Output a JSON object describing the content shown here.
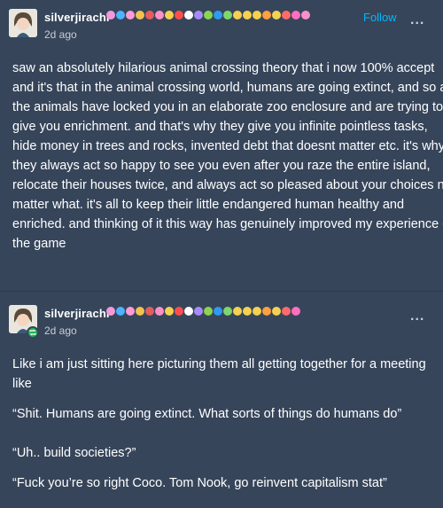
{
  "post1": {
    "username": "silverjirachi",
    "follow_label": "Follow",
    "timestamp": "2d ago",
    "more_label": "...",
    "badges": [
      "#f29ad8",
      "#4cb3ff",
      "#ff9ad5",
      "#f2c14e",
      "#e65c5c",
      "#ff8fc7",
      "#f5d14f",
      "#ff4d4d",
      "#ffffff",
      "#a78bfa",
      "#8bd450",
      "#2e9bf0",
      "#7fd66b",
      "#f5d14f",
      "#f5d14f",
      "#f5d14f",
      "#ff9f40",
      "#f5d14f",
      "#ff6b6b",
      "#ff6fbf",
      "#ff8fc7"
    ],
    "text": "saw an absolutely hilarious animal crossing theory that i now 100% accept and it's that in the animal crossing world, humans are going extinct, and so all the animals have locked you in an elaborate zoo enclosure and are trying to give you enrichment. and that's why they give you infinite pointless tasks, hide money in trees and rocks, invented debt that doesnt matter etc. it's why they always act so happy to see you even after you raze the entire island, relocate their houses twice, and always act so pleased about your choices no matter what.  it's all to keep their little endangered human healthy and enriched. and thinking of it this way has genuinely improved my experience of the game"
  },
  "post2": {
    "username": "silverjirachi",
    "timestamp": "2d ago",
    "more_label": "...",
    "paragraphs": [
      "Like i am just sitting here picturing them all getting together for a meeting like",
      "“Shit. Humans are going extinct. What sorts of things do humans do”",
      "“Uh.. build societies?”",
      "“Fuck you’re so right Coco. Tom Nook, go reinvent capitalism stat”"
    ]
  }
}
